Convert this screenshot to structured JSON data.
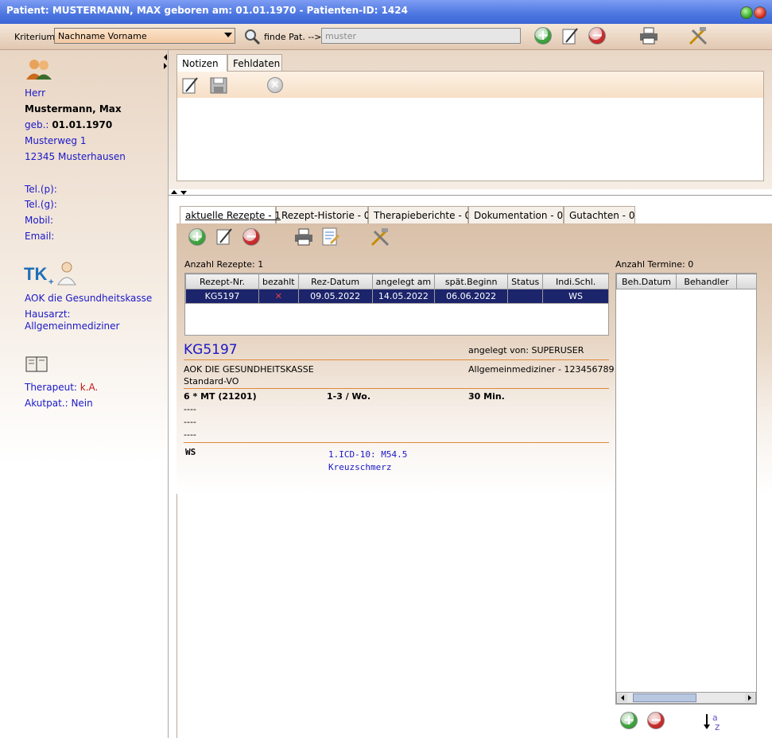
{
  "window": {
    "title": "Patient: MUSTERMANN, MAX geboren am: 01.01.1970 - Patienten-ID: 1424"
  },
  "toolbar": {
    "kriterium_label": "Kriterium:",
    "kriterium_value": "Nachname Vorname",
    "finde_label": "finde Pat. -->",
    "search_placeholder": "muster"
  },
  "patient": {
    "anrede": "Herr",
    "name": "Mustermann, Max",
    "geb_label": "geb.:",
    "geb_value": "01.01.1970",
    "street": "Musterweg 1",
    "city": "12345 Musterhausen",
    "tel_p": "Tel.(p):",
    "tel_g": "Tel.(g):",
    "mobil": "Mobil:",
    "email": "Email:",
    "kasse": "AOK die Gesundheitskasse",
    "hausarzt_label": "Hausarzt:",
    "hausarzt_value": "Allgemeinmediziner",
    "therapeut_label": "Therapeut:",
    "therapeut_value": "k.A.",
    "akutpat": "Akutpat.: Nein",
    "kasse_logo_text": "TK"
  },
  "notes_tabs": {
    "notizen": "Notizen",
    "fehldaten": "Fehldaten"
  },
  "main_tabs": [
    {
      "label": "aktuelle Rezepte - 1"
    },
    {
      "label": "Rezept-Historie - 0"
    },
    {
      "label": "Therapieberichte - 0"
    },
    {
      "label": "Dokumentation - 0"
    },
    {
      "label": "Gutachten - 0"
    }
  ],
  "rezepte": {
    "count_label": "Anzahl Rezepte: 1",
    "columns": [
      "Rezept-Nr.",
      "bezahlt",
      "Rez-Datum",
      "angelegt am",
      "spät.Beginn",
      "Status",
      "Indi.Schl."
    ],
    "rows": [
      {
        "nr": "KG5197",
        "bezahlt": "✕",
        "rez_datum": "09.05.2022",
        "angelegt": "14.05.2022",
        "beginn": "06.06.2022",
        "status": "",
        "indi": "WS"
      }
    ]
  },
  "termine": {
    "count_label": "Anzahl Termine: 0",
    "columns": [
      "Beh.Datum",
      "Behandler"
    ]
  },
  "detail": {
    "rezept_nr": "KG5197",
    "angelegt_von": "angelegt von: SUPERUSER",
    "kasse": "AOK DIE GESUNDHEITSKASSE",
    "arzt": "Allgemeinmediziner - 123456789",
    "vo": "Standard-VO",
    "line1_a": "6  *  MT (21201)",
    "line1_b": "1-3 / Wo.",
    "line1_c": "30 Min.",
    "dash1": "----",
    "dash2": "----",
    "dash3": "----",
    "indi": "WS",
    "icd": "1.ICD-10: M54.5",
    "diagnose": "Kreuzschmerz"
  }
}
